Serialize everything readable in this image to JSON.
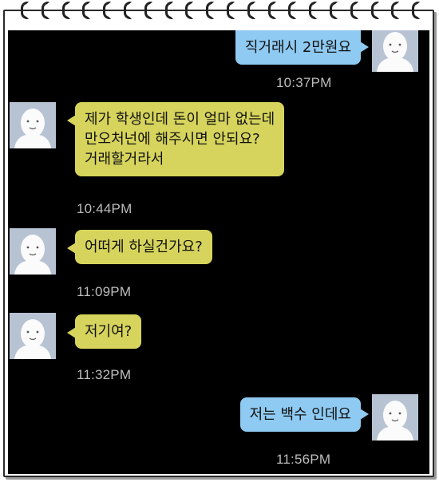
{
  "messages": [
    {
      "side": "sent",
      "text": "직거래시 2만원요",
      "time": "10:37PM"
    },
    {
      "side": "received",
      "text": "제가 학생인데 돈이 얼마 없는데\n만오처넌에 해주시면 안되요?\n거래할거라서",
      "time": "10:44PM"
    },
    {
      "side": "received",
      "text": "어떠게 하실건가요?",
      "time": "11:09PM"
    },
    {
      "side": "received",
      "text": "저기여?",
      "time": "11:32PM"
    },
    {
      "side": "sent",
      "text": "저는 백수 인데요",
      "time": "11:56PM"
    }
  ],
  "colors": {
    "screen_background": "#000000",
    "received_bubble": "#d6d45c",
    "sent_bubble": "#8fcaf2",
    "timestamp": "#bdbdbd",
    "avatar_background": "#b7c3d3"
  },
  "icons": {
    "avatar": "default-profile-avatar-icon",
    "binding": "spiral-ring-icon"
  }
}
